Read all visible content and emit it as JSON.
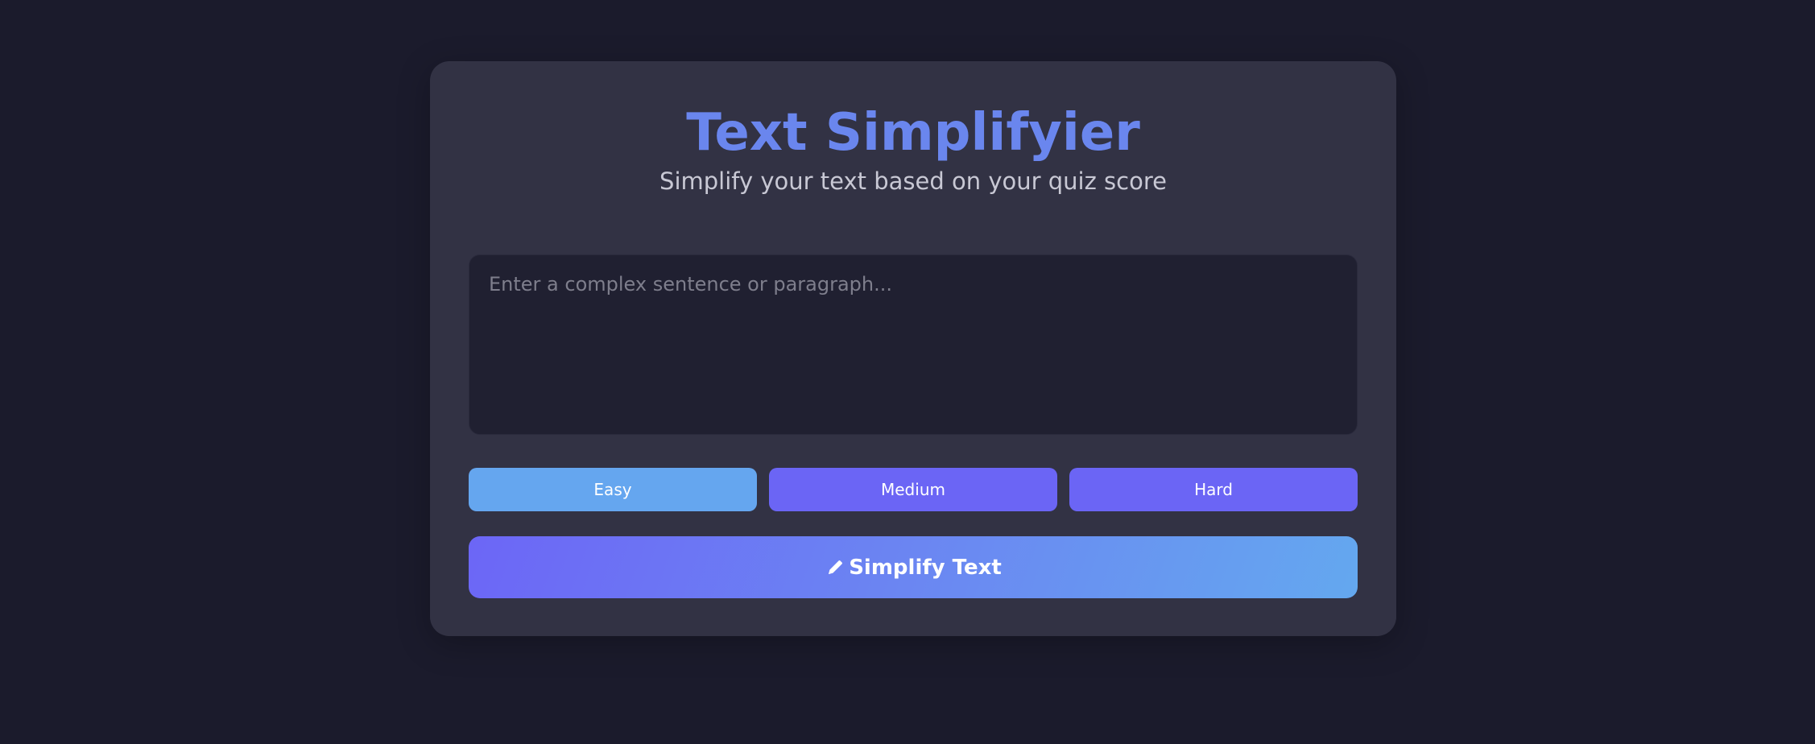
{
  "header": {
    "title": "Text Simplifyier",
    "subtitle": "Simplify your text based on your quiz score"
  },
  "input": {
    "value": "",
    "placeholder": "Enter a complex sentence or paragraph..."
  },
  "levels": [
    {
      "label": "Easy",
      "selected": true
    },
    {
      "label": "Medium",
      "selected": false
    },
    {
      "label": "Hard",
      "selected": false
    }
  ],
  "submit": {
    "label": "Simplify Text",
    "icon": "pencil-icon"
  },
  "colors": {
    "background": "#1b1b2c",
    "card": "#323244",
    "title": "#6a86ee",
    "selected_level": "#65a6ef",
    "unselected_level": "#6b65f5"
  }
}
